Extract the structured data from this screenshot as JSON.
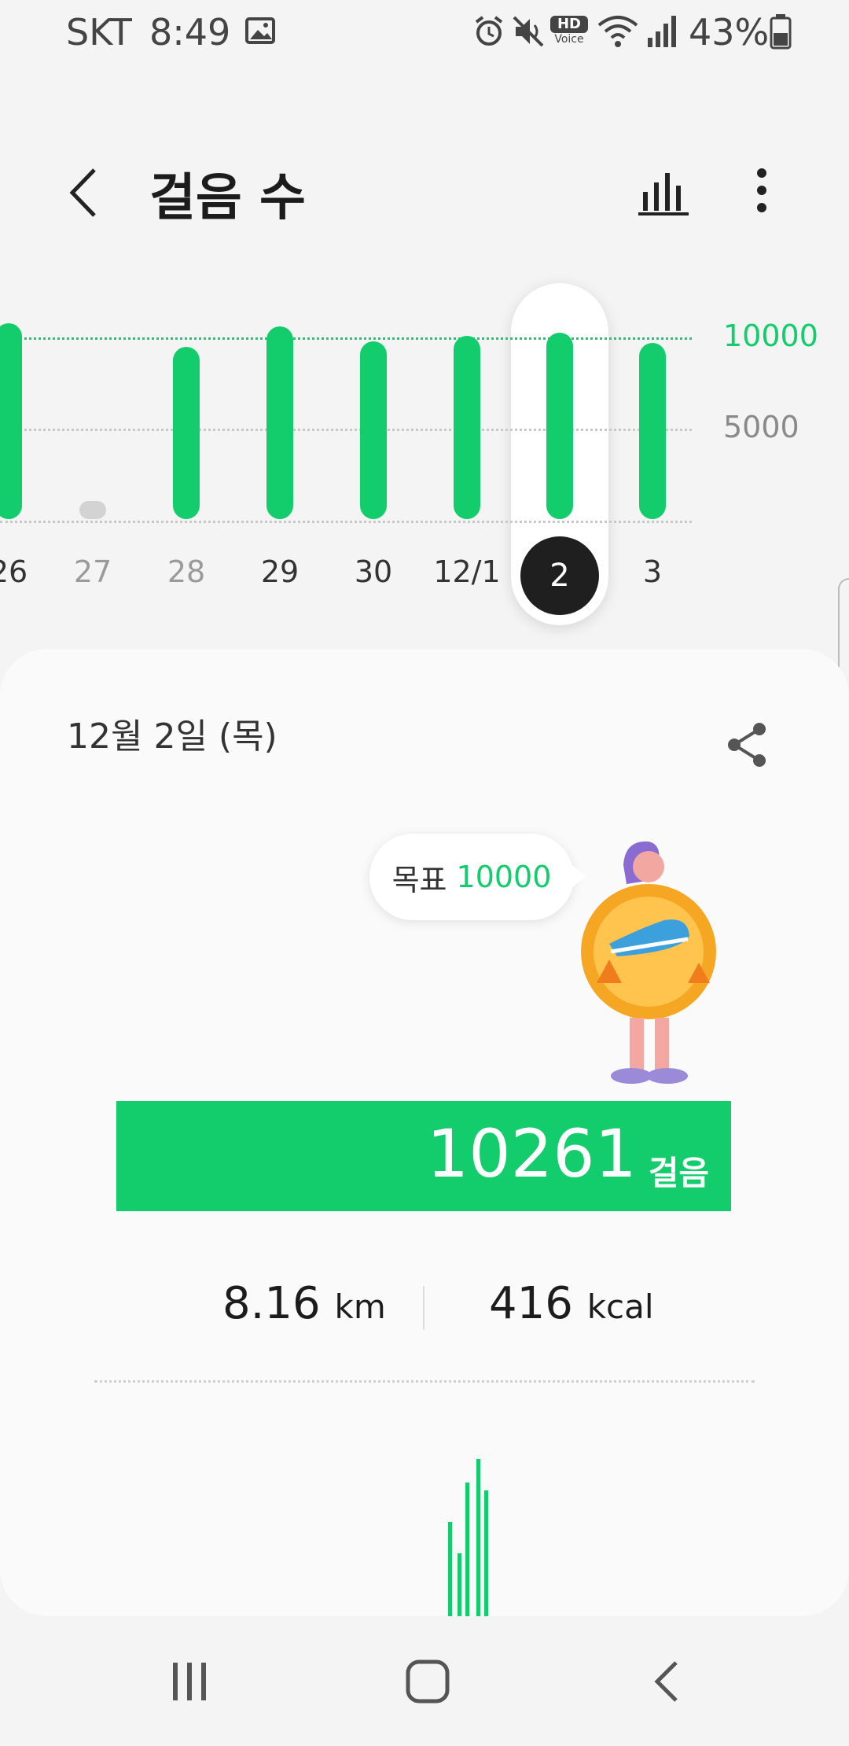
{
  "status_bar": {
    "carrier": "SKT",
    "time": "8:49",
    "battery": "43%",
    "icons": [
      "image-icon",
      "alarm-icon",
      "mute-icon",
      "hd-voice-icon",
      "wifi-icon",
      "signal-icon",
      "battery-icon"
    ],
    "hd_label": "HD",
    "voice_label": "Voice"
  },
  "header": {
    "title": "걸음 수",
    "back_icon": "chevron-left-icon",
    "chart_icon": "bar-chart-icon",
    "more_icon": "more-vert-icon"
  },
  "chart_data": {
    "type": "bar",
    "categories": [
      "26",
      "27",
      "28",
      "29",
      "30",
      "12/1",
      "2",
      "3"
    ],
    "values": [
      10800,
      1000,
      9500,
      10600,
      9800,
      10100,
      10261,
      9700
    ],
    "goal": 10000,
    "y_ticks": [
      "10000",
      "5000"
    ],
    "ylim": [
      0,
      13000
    ],
    "selected": "2",
    "colors": {
      "bar": "#13cd6c",
      "below_goal_bar": "#d3d3d3",
      "selected_bg": "#1f1f1f"
    }
  },
  "card": {
    "date": "12월 2일 (목)",
    "share_icon": "share-icon",
    "goal_label": "목표",
    "goal_value": "10000",
    "steps": "10261",
    "steps_unit": "걸음",
    "distance_value": "8.16",
    "distance_unit": "km",
    "calories_value": "416",
    "calories_unit": "kcal",
    "mini_chart_values": [
      0.6,
      0.4,
      0.85,
      1.0,
      0.8
    ]
  },
  "nav": {
    "recents_icon": "recents-icon",
    "home_icon": "home-icon",
    "back_icon": "back-icon"
  },
  "colors": {
    "accent": "#13cd6c",
    "background": "#f4f4f4",
    "card": "#fafafa"
  }
}
